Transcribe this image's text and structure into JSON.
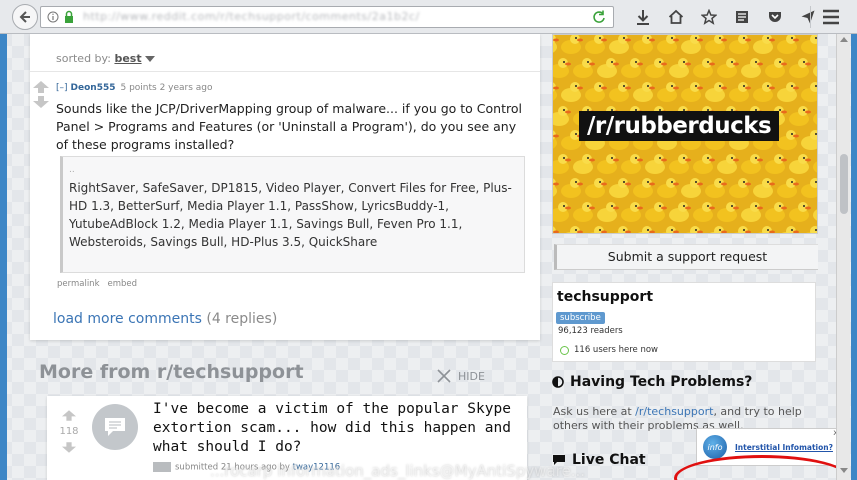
{
  "browser": {
    "url": "http://www.reddit.com/r/techsupport/comments/2a1b2c/",
    "toolbar_icons": [
      "download-icon",
      "home-icon",
      "bookmark-star-icon",
      "reader-icon",
      "pocket-icon",
      "send-icon",
      "menu-icon"
    ]
  },
  "comments": {
    "sorted_by_label": "sorted by:",
    "sorted_by_value": "best",
    "comment": {
      "toggle": "[–]",
      "author": "Deon555",
      "meta": "5 points 2 years ago",
      "body": "Sounds like the JCP/DriverMapping group of malware... if you go to Control Panel > Programs and Features (or 'Uninstall a Program'), do you see any of these programs installed?",
      "quote_mark": "..",
      "quote": "RightSaver, SafeSaver, DP1815, Video Player, Convert Files for Free, Plus-HD 1.3, BetterSurf, Media Player 1.1, PassShow, LyricsBuddy-1, YutubeAdBlock 1.2, Media Player 1.1, Savings Bull, Feven Pro 1.1, Websteroids, Savings Bull, HD-Plus 3.5, QuickShare",
      "permalink": "permalink",
      "embed": "embed"
    },
    "load_more_label": "load more comments",
    "load_more_count": "(4 replies)"
  },
  "more_from": {
    "title": "More from r/techsupport",
    "hide_label": "HIDE",
    "post": {
      "score": "118",
      "title": "I've become a victim of the popular Skype extortion scam... how did this happen and what should I do?",
      "meta": "submitted 21 hours ago by",
      "user": "tway12116"
    }
  },
  "watermark": "...rocarp information_ads_links@MyAntiSpyware...",
  "sidebar": {
    "banner_label": "/r/rubberducks",
    "support_button": "Submit a support request",
    "subreddit_name": "techsupport",
    "subscribe_label": "subscribe",
    "readers": "96,123 readers",
    "online": "116 users here now",
    "heading_tech": "Having Tech Problems?",
    "tech_text_before": "Ask us here at ",
    "tech_text_link": "/r/techsupport",
    "tech_text_after": ", and try to help others with their problems as well.",
    "heading_chat": "Live Chat"
  },
  "ad": {
    "logo_text": "info",
    "link_text": "Interstitial Infomation?",
    "close": "x",
    "highlight_color": "#e01010"
  },
  "colors": {
    "frame_blue": "#3d86c6",
    "link_blue": "#3b75b5",
    "subscribe_blue": "#5f99cf"
  }
}
